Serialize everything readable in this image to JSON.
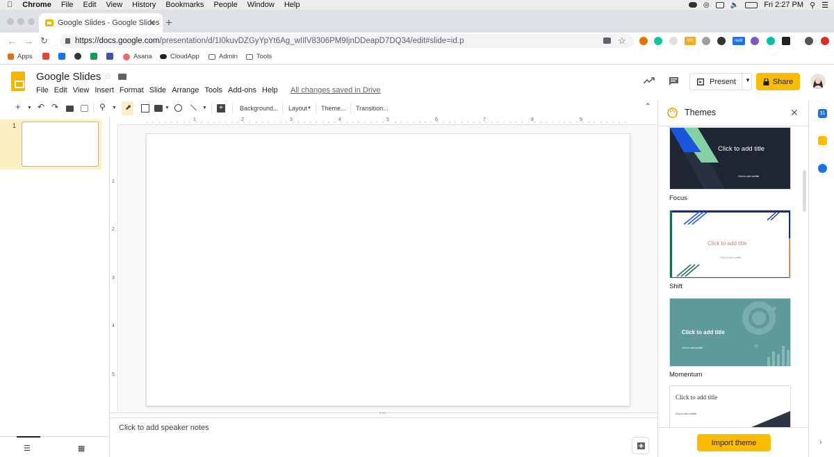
{
  "macos": {
    "app_name": "Chrome",
    "menu": [
      "File",
      "Edit",
      "View",
      "History",
      "Bookmarks",
      "People",
      "Window",
      "Help"
    ],
    "clock": "Fri 2:27 PM"
  },
  "browser": {
    "tab_title": "Google Slides - Google Slides",
    "url_host": "https://docs.google.com",
    "url_path": "/presentation/d/1I0kuvDZGyYpYt6Ag_wIIlV8306PM9IjnDDeapD7DQ34/edit#slide=id.p",
    "bookmarks": [
      "Apps",
      "Asana",
      "CloudApp",
      "Admin",
      "Tools"
    ],
    "ext_badges": [
      "302",
      "redir"
    ]
  },
  "doc": {
    "title": "Google Slides",
    "menus": [
      "File",
      "Edit",
      "View",
      "Insert",
      "Format",
      "Slide",
      "Arrange",
      "Tools",
      "Add-ons",
      "Help"
    ],
    "save_status": "All changes saved in Drive",
    "present_label": "Present",
    "share_label": "Share"
  },
  "toolbar": {
    "background": "Background...",
    "layout": "Layout",
    "theme": "Theme...",
    "transition": "Transition..."
  },
  "ruler": {
    "h_labels": [
      "1",
      "2",
      "3",
      "4",
      "5",
      "6",
      "7",
      "8",
      "9"
    ],
    "v_labels": [
      "1",
      "2",
      "3",
      "4",
      "5"
    ]
  },
  "filmstrip": {
    "slide_number": "1"
  },
  "notes": {
    "placeholder": "Click to add speaker notes"
  },
  "themes": {
    "panel_title": "Themes",
    "cards": [
      {
        "name": "Focus",
        "title": "Click to add title",
        "subtitle": "Click to add subtitle"
      },
      {
        "name": "Shift",
        "title": "Click to add title",
        "subtitle": "Click to add subtitle"
      },
      {
        "name": "Momentum",
        "title": "Click to add title",
        "subtitle": "Click to add subtitle"
      },
      {
        "name": "",
        "title": "Click to add title",
        "subtitle": "Click to add subtitle"
      }
    ],
    "import_label": "Import theme"
  },
  "colors": {
    "accent_yellow": "#fbbc04",
    "focus_bg": "#1f2532",
    "shift_green": "#1e6b5a",
    "momentum_teal": "#5e9a9a"
  }
}
